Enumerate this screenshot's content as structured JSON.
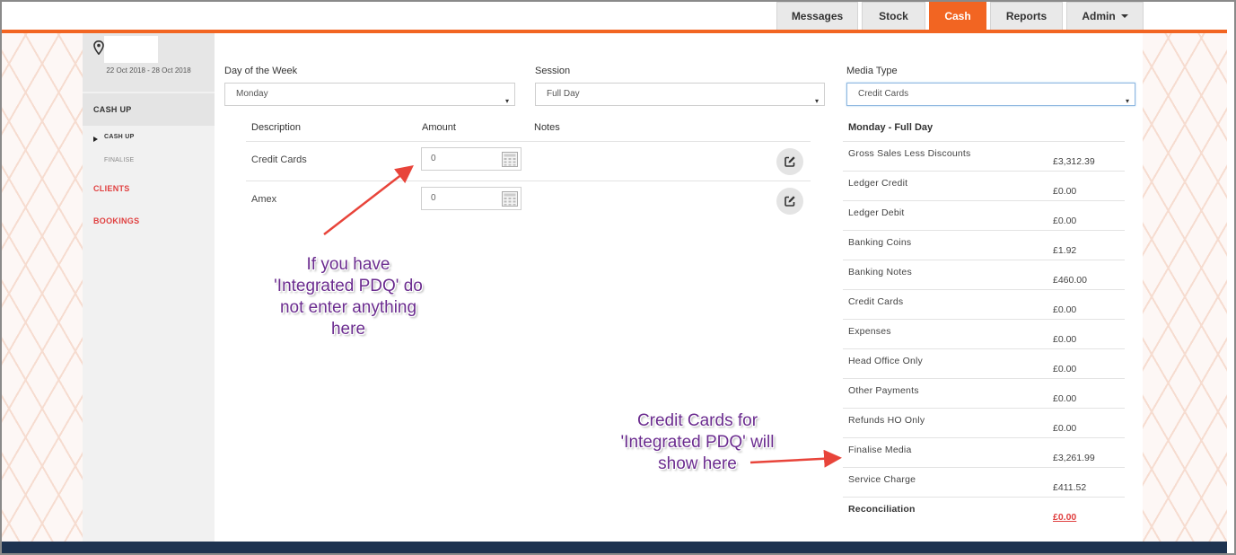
{
  "nav": {
    "tabs": [
      {
        "label": "Messages",
        "active": false
      },
      {
        "label": "Stock",
        "active": false
      },
      {
        "label": "Cash",
        "active": true
      },
      {
        "label": "Reports",
        "active": false
      },
      {
        "label": "Admin",
        "active": false
      }
    ]
  },
  "colors": {
    "accent": "#f26522",
    "footer": "#1e3350",
    "link_red": "#e04040",
    "annotation": "#6b2c8f",
    "arrow": "#e8443a"
  },
  "sidebar": {
    "location_icon": "map-pin-icon",
    "date_range": "22 Oct 2018 - 28 Oct 2018",
    "section_title": "CASH UP",
    "sub_items": [
      "CASH UP",
      "FINALISE"
    ],
    "links": [
      "CLIENTS",
      "BOOKINGS"
    ]
  },
  "filters": {
    "day_label": "Day of the Week",
    "day_value": "Monday",
    "session_label": "Session",
    "session_value": "Full Day",
    "media_label": "Media Type",
    "media_value": "Credit Cards"
  },
  "table": {
    "headers": [
      "Description",
      "Amount",
      "Notes"
    ],
    "rows": [
      {
        "description": "Credit Cards",
        "amount": "0"
      },
      {
        "description": "Amex",
        "amount": "0"
      }
    ]
  },
  "summary": {
    "title": "Monday - Full Day",
    "rows": [
      {
        "label": "Gross Sales Less Discounts",
        "value": "£3,312.39"
      },
      {
        "label": "Ledger Credit",
        "value": "£0.00"
      },
      {
        "label": "Ledger Debit",
        "value": "£0.00"
      },
      {
        "label": "Banking Coins",
        "value": "£1.92"
      },
      {
        "label": "Banking Notes",
        "value": "£460.00"
      },
      {
        "label": "Credit Cards",
        "value": "£0.00"
      },
      {
        "label": "Expenses",
        "value": "£0.00"
      },
      {
        "label": "Head Office Only",
        "value": "£0.00"
      },
      {
        "label": "Other Payments",
        "value": "£0.00"
      },
      {
        "label": "Refunds HO Only",
        "value": "£0.00"
      },
      {
        "label": "Finalise Media",
        "value": "£3,261.99"
      },
      {
        "label": "Service Charge",
        "value": "£411.52"
      }
    ],
    "reconciliation_label": "Reconciliation",
    "reconciliation_value": "£0.00"
  },
  "annotations": {
    "note_1": [
      "If you have",
      "'Integrated PDQ' do",
      "not enter anything",
      "here"
    ],
    "note_2": [
      "Credit Cards for",
      "'Integrated PDQ' will",
      "show here"
    ]
  }
}
